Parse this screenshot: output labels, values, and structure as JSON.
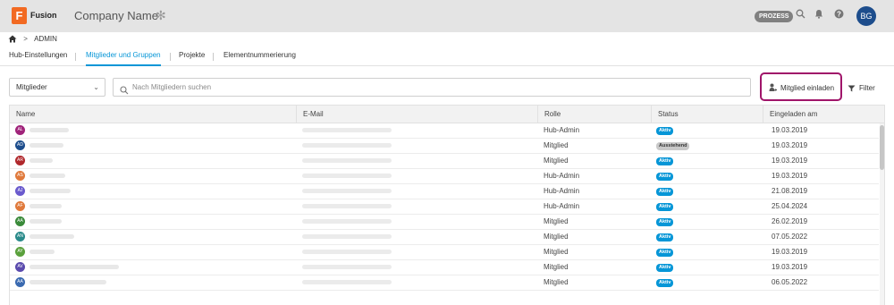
{
  "app": {
    "logo_letter": "F",
    "logo_text": "Fusion",
    "company_name": "Company Name",
    "spark_icon": "snowflake-icon",
    "prozess_badge": "PROZESS",
    "user_initials": "BG",
    "colors": {
      "topbar": "#e4e4e4",
      "accent": "#0696d7",
      "logo": "#f26a22",
      "avatar": "#1d4d8c",
      "highlight": "#a0156a"
    }
  },
  "breadcrumb": {
    "home_icon": "home-icon",
    "separator": ">",
    "current": "ADMIN"
  },
  "tabs": [
    {
      "label": "Hub-Einstellungen",
      "active": false
    },
    {
      "label": "Mitglieder und Gruppen",
      "active": true
    },
    {
      "label": "Projekte",
      "active": false
    },
    {
      "label": "Elementnummerierung",
      "active": false
    }
  ],
  "toolbar": {
    "dropdown_value": "Mitglieder",
    "search_placeholder": "Nach Mitgliedern suchen",
    "invite_label": "Mitglied einladen",
    "filter_label": "Filter"
  },
  "table": {
    "columns": [
      "Name",
      "E-Mail",
      "Rolle",
      "Status",
      "Eingeladen am"
    ],
    "rows": [
      {
        "initials": "AL",
        "color": "#a0237a",
        "role": "Hub-Admin",
        "status": "Aktiv",
        "date": "19.03.2019"
      },
      {
        "initials": "AD",
        "color": "#1d4d8c",
        "role": "Mitglied",
        "status": "Ausstehend",
        "date": "19.03.2019"
      },
      {
        "initials": "AR",
        "color": "#b0282c",
        "role": "Mitglied",
        "status": "Aktiv",
        "date": "19.03.2019"
      },
      {
        "initials": "AS",
        "color": "#e07a3c",
        "role": "Hub-Admin",
        "status": "Aktiv",
        "date": "19.03.2019"
      },
      {
        "initials": "AJ",
        "color": "#6a5acd",
        "role": "Hub-Admin",
        "status": "Aktiv",
        "date": "21.08.2019"
      },
      {
        "initials": "AF",
        "color": "#e07a3c",
        "role": "Hub-Admin",
        "status": "Aktiv",
        "date": "25.04.2024"
      },
      {
        "initials": "AA",
        "color": "#3a8a3a",
        "role": "Mitglied",
        "status": "Aktiv",
        "date": "26.02.2019"
      },
      {
        "initials": "AN",
        "color": "#2a8a8a",
        "role": "Mitglied",
        "status": "Aktiv",
        "date": "07.05.2022"
      },
      {
        "initials": "AY",
        "color": "#5aa03c",
        "role": "Mitglied",
        "status": "Aktiv",
        "date": "19.03.2019"
      },
      {
        "initials": "AV",
        "color": "#5a4aad",
        "role": "Mitglied",
        "status": "Aktiv",
        "date": "19.03.2019"
      },
      {
        "initials": "AA",
        "color": "#3a6ab0",
        "role": "Mitglied",
        "status": "Aktiv",
        "date": "06.05.2022"
      }
    ]
  }
}
